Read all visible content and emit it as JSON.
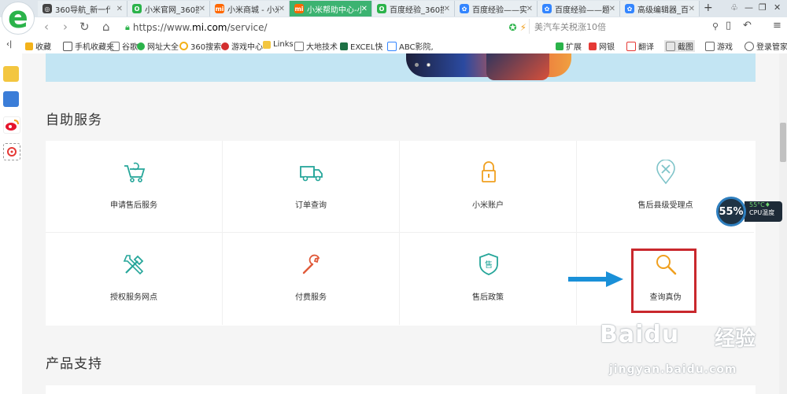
{
  "tabs": [
    {
      "title": "360导航_新一代",
      "icon_color": "#444",
      "active": false
    },
    {
      "title": "小米官网_360搜",
      "icon_color": "#2bb34a",
      "active": false
    },
    {
      "title": "小米商城 - 小米",
      "icon_color": "#ff6700",
      "active": false
    },
    {
      "title": "小米帮助中心-小",
      "icon_color": "#ff6700",
      "active": true
    },
    {
      "title": "百度经验_360搜",
      "icon_color": "#2bb34a",
      "active": false
    },
    {
      "title": "百度经验——实",
      "icon_color": "#3385ff",
      "active": false
    },
    {
      "title": "百度经验——题",
      "icon_color": "#3385ff",
      "active": false
    },
    {
      "title": "高级编辑器_百度",
      "icon_color": "#3385ff",
      "active": false
    }
  ],
  "address": {
    "prefix": "https://www.",
    "domain": "mi.com",
    "path": "/service/",
    "search_text": "美汽车关税涨10倍"
  },
  "bookmarks": [
    "收藏",
    "手机收藏夹",
    "谷歌",
    "网址大全",
    "360搜索",
    "游戏中心",
    "Links",
    "大地技术",
    "EXCEL快",
    "ABC影院,"
  ],
  "toolbar_right": [
    "扩展",
    "网银",
    "翻译",
    "截图",
    "游戏",
    "登录管家"
  ],
  "sections": {
    "self_service": "自助服务",
    "product_support": "产品支持"
  },
  "services": [
    {
      "label": "申请售后服务",
      "icon": "cart-return-icon"
    },
    {
      "label": "订单查询",
      "icon": "truck-icon"
    },
    {
      "label": "小米账户",
      "icon": "lock-icon"
    },
    {
      "label": "售后县级受理点",
      "icon": "location-tools-icon"
    },
    {
      "label": "授权服务网点",
      "icon": "tools-icon"
    },
    {
      "label": "付费服务",
      "icon": "wrench-icon"
    },
    {
      "label": "售后政策",
      "icon": "shield-sale-icon"
    },
    {
      "label": "查询真伪",
      "icon": "magnifier-icon"
    }
  ],
  "service_icon_badge": "售",
  "cpu_widget": {
    "percent": "55%",
    "temp": "55°C",
    "label": "CPU温度"
  },
  "watermark": {
    "brand": "Baidu",
    "cn": "经验",
    "url": "jingyan.baidu.com"
  },
  "colors": {
    "tab_active": "#3cb371",
    "icon_teal": "#26a69a",
    "icon_orange": "#f0a020",
    "icon_red": "#e05a3a",
    "highlight": "#c9282d",
    "arrow": "#1a90d8"
  }
}
